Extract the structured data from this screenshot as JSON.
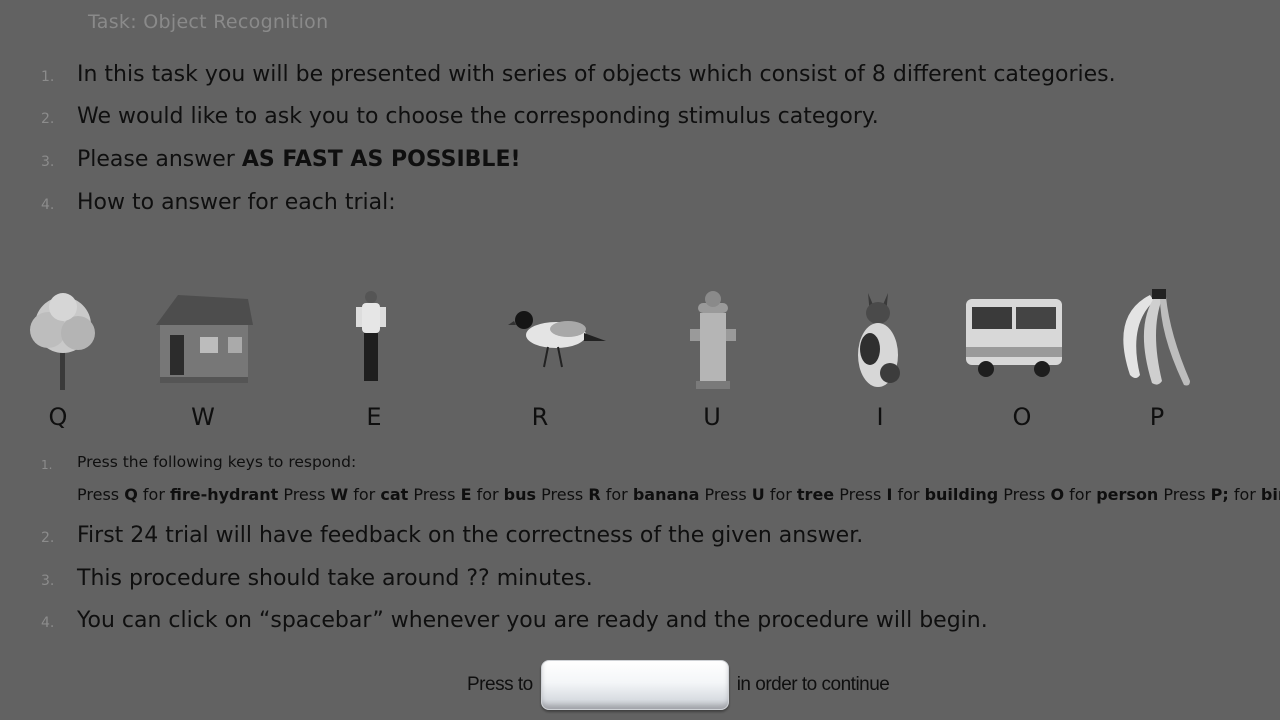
{
  "title": "Task: Object Recognition",
  "intro_items": [
    {
      "num": "1.",
      "text": "In this task you will be presented with series of objects which consist of 8 different categories."
    },
    {
      "num": "2.",
      "text": "We would like to ask you to choose the corresponding stimulus category."
    },
    {
      "num": "3.",
      "text_prefix": "Please answer ",
      "text_bold": "AS FAST AS POSSIBLE!"
    },
    {
      "num": "4.",
      "text": "How to answer for each trial:"
    }
  ],
  "stimuli": [
    {
      "key": "Q",
      "object": "tree",
      "icon": "tree-icon"
    },
    {
      "key": "W",
      "object": "building",
      "icon": "building-icon"
    },
    {
      "key": "E",
      "object": "person",
      "icon": "person-icon"
    },
    {
      "key": "R",
      "object": "bird",
      "icon": "bird-icon"
    },
    {
      "key": "U",
      "object": "fire-hydrant",
      "icon": "fire-hydrant-icon"
    },
    {
      "key": "I",
      "object": "cat",
      "icon": "cat-icon"
    },
    {
      "key": "O",
      "object": "bus",
      "icon": "bus-icon"
    },
    {
      "key": "P",
      "object": "banana",
      "icon": "banana-icon"
    }
  ],
  "respond": {
    "num": "1.",
    "text": "Press the following keys to respond:",
    "mappings": [
      {
        "press": "Press ",
        "key": "Q",
        "for": " for ",
        "label": "fire-hydrant"
      },
      {
        "press": " Press ",
        "key": "W",
        "for": " for ",
        "label": "cat"
      },
      {
        "press": " Press ",
        "key": "E",
        "for": " for ",
        "label": "bus"
      },
      {
        "press": " Press ",
        "key": "R",
        "for": " for ",
        "label": "banana"
      },
      {
        "press": " Press ",
        "key": "U",
        "for": " for ",
        "label": "tree"
      },
      {
        "press": " Press ",
        "key": "I",
        "for": " for ",
        "label": "building"
      },
      {
        "press": " Press ",
        "key": "O",
        "for": " for ",
        "label": "person"
      },
      {
        "press": " Press ",
        "key": "P;",
        "for": " for ",
        "label": "bird"
      }
    ]
  },
  "outro_items": [
    {
      "num": "2.",
      "text": "First 24 trial will have feedback on the correctness of the given answer."
    },
    {
      "num": "3.",
      "text": "This procedure should take around ?? minutes."
    },
    {
      "num": "4.",
      "text": "You can click on “spacebar” whenever you are ready and the procedure will begin."
    }
  ],
  "continue": {
    "before": "Press to",
    "key_icon": "spacebar-key-icon",
    "after": "in order to continue"
  }
}
